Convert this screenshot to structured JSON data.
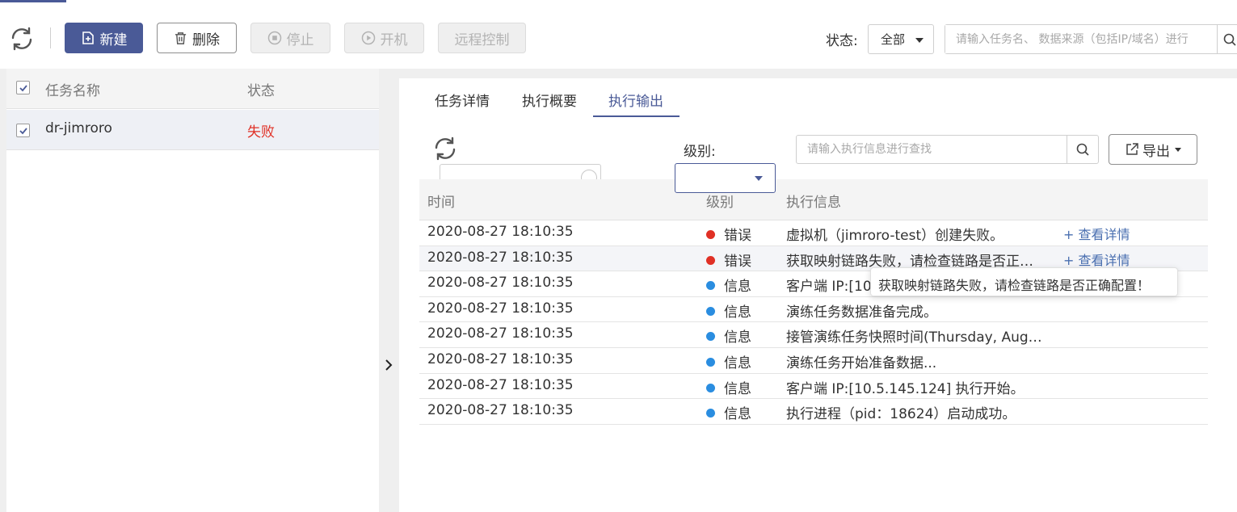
{
  "colors": {
    "accent": "#4a5a97",
    "failure": "#e03025",
    "error_dot": "#e03025",
    "info_dot": "#2a8de0",
    "link": "#4a6fb0"
  },
  "toolbar": {
    "refresh_icon": "refresh-icon",
    "new_label": "新建",
    "delete_label": "删除",
    "stop_label": "停止",
    "start_label": "开机",
    "remote_label": "远程控制",
    "status_label": "状态:",
    "status_value": "全部",
    "search_placeholder": "请输入任务名、 数据来源（包括IP/域名）进行"
  },
  "task_list": {
    "header_name": "任务名称",
    "header_state": "状态",
    "rows": [
      {
        "name": "dr-jimroro",
        "state": "失败"
      }
    ]
  },
  "detail": {
    "tabs": [
      "任务详情",
      "执行概要",
      "执行输出"
    ],
    "active_tab": "执行输出",
    "level_label": "级别:",
    "level_value": "",
    "search_placeholder": "请输入执行信息进行查找",
    "export_label": "导出",
    "columns": {
      "time": "时间",
      "level": "级别",
      "message": "执行信息"
    },
    "rows": [
      {
        "time": "2020-08-27 18:10:35",
        "level": "错误",
        "level_type": "error",
        "message": "虚拟机（jimroro-test）创建失败。",
        "detail": "+ 查看详情"
      },
      {
        "time": "2020-08-27 18:10:35",
        "level": "错误",
        "level_type": "error",
        "message": "获取映射链路失败，请检查链路是否正…",
        "detail": "+ 查看详情"
      },
      {
        "time": "2020-08-27 18:10:35",
        "level": "信息",
        "level_type": "info",
        "message": "客户端 IP:[10.",
        "detail": ""
      },
      {
        "time": "2020-08-27 18:10:35",
        "level": "信息",
        "level_type": "info",
        "message": "演练任务数据准备完成。",
        "detail": ""
      },
      {
        "time": "2020-08-27 18:10:35",
        "level": "信息",
        "level_type": "info",
        "message": "接管演练任务快照时间(Thursday, Aug…",
        "detail": ""
      },
      {
        "time": "2020-08-27 18:10:35",
        "level": "信息",
        "level_type": "info",
        "message": "演练任务开始准备数据...",
        "detail": ""
      },
      {
        "time": "2020-08-27 18:10:35",
        "level": "信息",
        "level_type": "info",
        "message": "客户端 IP:[10.5.145.124] 执行开始。",
        "detail": ""
      },
      {
        "time": "2020-08-27 18:10:35",
        "level": "信息",
        "level_type": "info",
        "message": "执行进程（pid：18624）启动成功。",
        "detail": ""
      }
    ],
    "tooltip": "获取映射链路失败，请检查链路是否正确配置！"
  }
}
